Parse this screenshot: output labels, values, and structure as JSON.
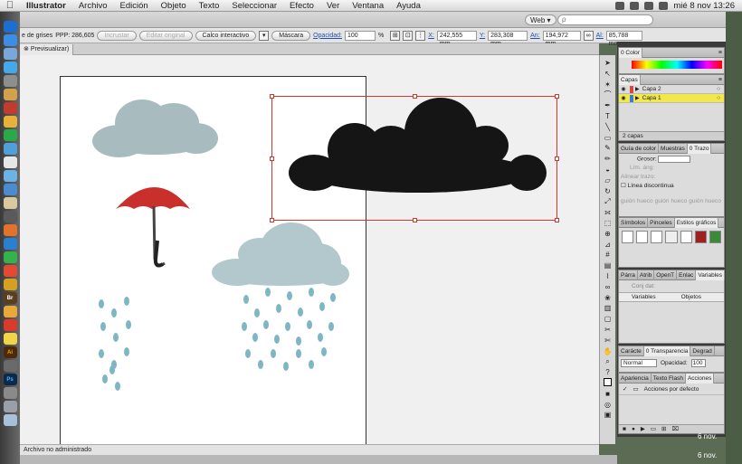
{
  "menubar": {
    "apple_icon": "apple-icon",
    "app_name": "Illustrator",
    "items": [
      "Archivo",
      "Edición",
      "Objeto",
      "Texto",
      "Seleccionar",
      "Efecto",
      "Ver",
      "Ventana",
      "Ayuda"
    ],
    "clock": "mié 8 nov  13:26"
  },
  "app": {
    "workspace": "Web ▾",
    "search_placeholder": "ρ"
  },
  "control": {
    "mode_label": "e de grises",
    "ppp_label": "PPP: 286,605",
    "embed": "Incrustar",
    "edit_original": "Editar original",
    "live_trace": "Calco interactivo",
    "mask": "Máscara",
    "opacity_label": "Opacidad:",
    "opacity_value": "100",
    "opacity_unit": "%",
    "x_label": "X:",
    "x_value": "242,555 mm",
    "y_label": "Y:",
    "y_value": "283,308 mm",
    "w_label": "An:",
    "w_value": "194,972 mm",
    "h_label": "Al:",
    "h_value": "85,788 mm"
  },
  "document": {
    "tab_label": "Previsualizar)",
    "status": "Archivo no administrado"
  },
  "panels": {
    "color": {
      "tabs": [
        "0 Color"
      ]
    },
    "layers": {
      "tabs": [
        "Capas"
      ],
      "rows": [
        {
          "name": "Capa 2",
          "color": "#e0453a"
        },
        {
          "name": "Capa 1",
          "color": "#3b7be0"
        }
      ],
      "footer": "2 capas"
    },
    "stroke": {
      "tabs": [
        "Guía de color",
        "Muestras",
        "0 Trazo"
      ],
      "weight_label": "Grosor:",
      "limit_label": "Lím. áng:",
      "align_label": "Alinear trazo:",
      "dashed_label": "Línea discontinua",
      "dash_labels": [
        "guión",
        "hueco",
        "guión",
        "hueco",
        "guión",
        "hueco"
      ]
    },
    "symbols": {
      "tabs": [
        "Símbolos",
        "Pinceles",
        "Estilos gráficos"
      ]
    },
    "variables": {
      "tabs": [
        "Párra",
        "Atrib",
        "OpenT",
        "Enlac",
        "Variables"
      ],
      "dataset": "Conj dat:",
      "col_variables": "Variables",
      "col_objects": "Objetos"
    },
    "transparency": {
      "tabs": [
        "Carácte",
        "0 Transparencia",
        "Degrad"
      ],
      "blend": "Normal",
      "opacity_label": "Opacidad:",
      "opacity_value": "100"
    },
    "actions": {
      "tabs": [
        "Apariencia",
        "Texto Flash",
        "Acciones"
      ],
      "set": "Acciones por defecto"
    }
  },
  "desktop": {
    "dates": [
      "6 nov.",
      "6 nov."
    ]
  }
}
